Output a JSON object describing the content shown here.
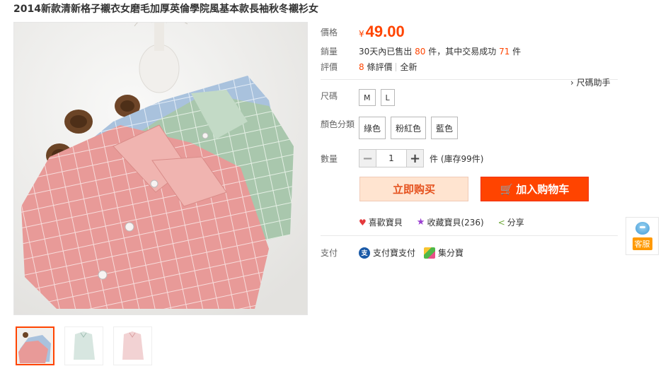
{
  "product": {
    "title": "2014新款清新格子襯衣女磨毛加厚英倫學院風基本款長袖秋冬襯衫女"
  },
  "price": {
    "label": "價格",
    "currency": "¥",
    "value": "49.00"
  },
  "sales": {
    "label": "銷量",
    "prefix": "30天內已售出",
    "sold": "80",
    "middle": "件，其中交易成功",
    "success": "71",
    "suffix": "件"
  },
  "evaluation": {
    "label": "評價",
    "count": "8",
    "count_text": "條評價",
    "tag": "全新"
  },
  "size_help": "› 尺碼助手",
  "size": {
    "label": "尺碼",
    "options": [
      "M",
      "L"
    ]
  },
  "color": {
    "label": "顏色分類",
    "options": [
      "綠色",
      "粉紅色",
      "藍色"
    ]
  },
  "quantity": {
    "label": "數量",
    "minus": "−",
    "plus": "+",
    "value": "1",
    "stock": "件 (庫存99件)"
  },
  "buttons": {
    "buy_now": "立即购买",
    "add_cart": "加入购物车",
    "cart_icon": "🛒"
  },
  "social": {
    "like": "喜歡寶貝",
    "collect": "收藏寶貝(236)",
    "share": "分享",
    "heart_icon": "♥",
    "star_icon": "★",
    "share_icon": "<"
  },
  "payment": {
    "label": "支付",
    "alipay": "支付寶支付",
    "alipay_icon": "支",
    "jifen": "集分寶"
  },
  "service": {
    "label": "客服"
  },
  "colors": {
    "accent": "#ff4400",
    "price": "#ff4400",
    "shirt_pink": "#e89a98",
    "shirt_green": "#a9c7ad",
    "shirt_blue": "#a9c2dd"
  }
}
